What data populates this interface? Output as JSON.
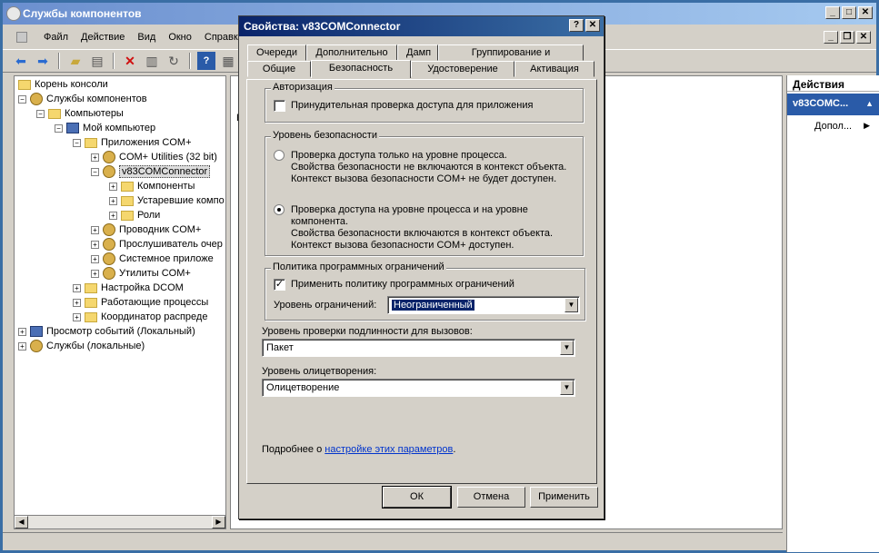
{
  "window": {
    "title": "Службы компонентов"
  },
  "menu": [
    "Файл",
    "Действие",
    "Вид",
    "Окно",
    "Справка"
  ],
  "tree": {
    "items": [
      "Корень консоли",
      "Службы компонентов",
      "Компьютеры",
      "Мой компьютер",
      "Приложения COM+",
      "COM+ Utilities (32 bit)",
      "v83COMConnector",
      "Компоненты",
      "Устаревшие компо",
      "Роли",
      "Проводник COM+",
      "Прослушиватель очер",
      "Системное приложе",
      "Утилиты COM+",
      "Настройка DCOM",
      "Работающие процессы",
      "Координатор распреде",
      "Просмотр событий (Локальный)",
      "Службы (локальные)"
    ]
  },
  "main": {
    "text": "К"
  },
  "actions": {
    "header": "Действия",
    "selected": "v83COMC...",
    "item": "Допол..."
  },
  "dialog": {
    "title": "Свойства: v83COMConnector",
    "tabs_row1": [
      "Очереди",
      "Дополнительно",
      "Дамп",
      "Группирование и перезапуск"
    ],
    "tabs_row2": [
      "Общие",
      "Безопасность",
      "Удостоверение",
      "Активация"
    ],
    "authorization": {
      "title": "Авторизация",
      "checkbox": "Принудительная проверка доступа для приложения"
    },
    "security_level": {
      "title": "Уровень безопасности",
      "opt1": [
        "Проверка доступа только на уровне процесса.",
        "Свойства безопасности не включаются в контекст объекта.",
        "Контекст вызова безопасности COM+ не будет доступен."
      ],
      "opt2": [
        "Проверка доступа на уровне процесса и на уровне",
        "компонента.",
        "Свойства безопасности включаются в контекст объекта.",
        "Контекст вызова безопасности COM+ доступен."
      ]
    },
    "srp": {
      "title": "Политика программных ограничений",
      "checkbox": "Применить  политику программных ограничений",
      "level_label": "Уровень ограничений:",
      "level_value": "Неограниченный"
    },
    "auth_level": {
      "label": "Уровень проверки подлинности для вызовов:",
      "value": "Пакет"
    },
    "impersonation": {
      "label": "Уровень олицетворения:",
      "value": "Олицетворение"
    },
    "more": {
      "prefix": "Подробнее о ",
      "link": "настройке этих параметров",
      "suffix": "."
    },
    "buttons": {
      "ok": "ОК",
      "cancel": "Отмена",
      "apply": "Применить"
    }
  }
}
